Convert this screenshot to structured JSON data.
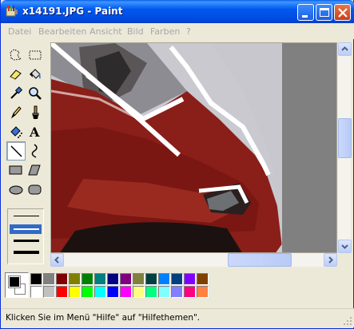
{
  "window": {
    "title": "x14191.JPG - Paint",
    "controls": [
      "minimize",
      "maximize",
      "close"
    ]
  },
  "menu": {
    "items": [
      "Datei",
      "Bearbeiten",
      "Ansicht",
      "Bild",
      "Farben",
      "?"
    ]
  },
  "toolbox": {
    "tools": [
      "free-select-icon",
      "rect-select-icon",
      "eraser-icon",
      "fill-bucket-icon",
      "color-picker-icon",
      "magnifier-icon",
      "pencil-icon",
      "brush-icon",
      "airbrush-icon",
      "text-icon",
      "line-icon",
      "curve-icon",
      "rectangle-icon",
      "polygon-icon",
      "ellipse-icon",
      "rounded-rect-icon"
    ],
    "active_tool": "line-icon",
    "line_widths": [
      1,
      2,
      3,
      4
    ],
    "selected_width": 2
  },
  "colors": {
    "foreground": "#000000",
    "background": "#FFFFFF",
    "palette_top": [
      "#000000",
      "#808080",
      "#800000",
      "#808000",
      "#008000",
      "#008080",
      "#000080",
      "#800080",
      "#808040",
      "#004040",
      "#0080FF",
      "#004080",
      "#8000FF",
      "#804000"
    ],
    "palette_bottom": [
      "#FFFFFF",
      "#C0C0C0",
      "#FF0000",
      "#FFFF00",
      "#00FF00",
      "#00FFFF",
      "#0000FF",
      "#FF00FF",
      "#FFFF80",
      "#00FF80",
      "#80FFFF",
      "#8080FF",
      "#FF0080",
      "#FF8040"
    ]
  },
  "status": {
    "text": "Klicken Sie im Menü \"Hilfe\" auf \"Hilfethemen\"."
  }
}
